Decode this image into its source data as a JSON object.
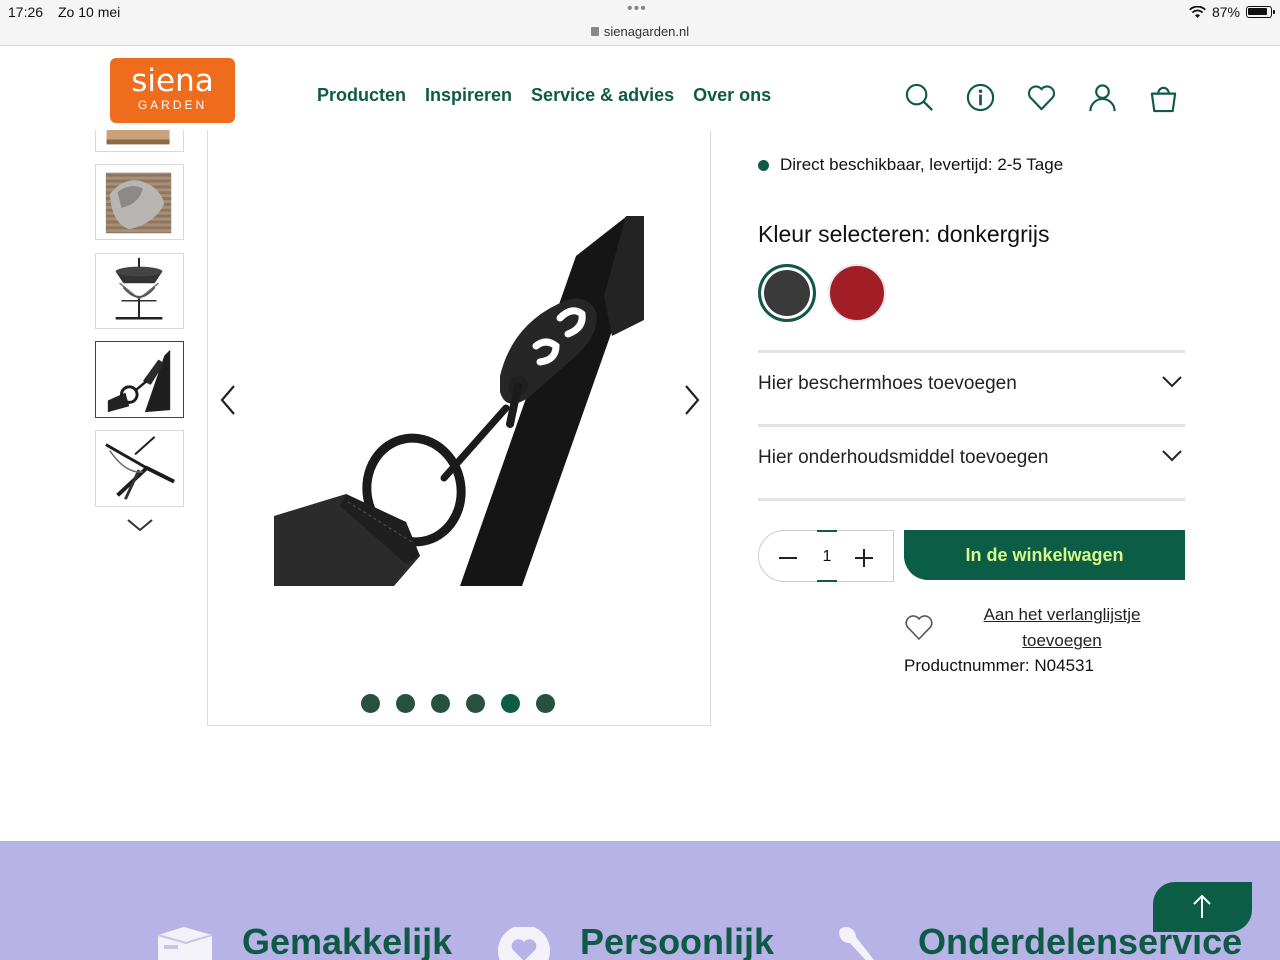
{
  "status_bar": {
    "time": "17:26",
    "date": "Zo 10 mei",
    "url": "sienagarden.nl",
    "battery": "87%"
  },
  "header": {
    "logo_line1": "siena",
    "logo_line2": "GARDEN",
    "nav": [
      "Producten",
      "Inspireren",
      "Service & advies",
      "Over ons"
    ],
    "icons": [
      "search-icon",
      "info-icon",
      "heart-icon",
      "user-icon",
      "bag-icon"
    ]
  },
  "gallery": {
    "thumbnails": [
      "thumb-partial",
      "thumb-cushion",
      "thumb-stand",
      "thumb-hook",
      "thumb-frame"
    ],
    "selected_thumbnail": 3,
    "slide_count": 6,
    "active_slide": 4
  },
  "product": {
    "availability": "Direct beschikbaar, levertijd: 2-5 Tage",
    "color_label": "Kleur selecteren: donkergrijs",
    "colors": [
      {
        "name": "donkergrijs",
        "hex": "#3a3a3a",
        "selected": true
      },
      {
        "name": "rood",
        "hex": "#a21e26",
        "selected": false
      }
    ],
    "accordions": [
      "Hier beschermhoes toevoegen",
      "Hier onderhoudsmiddel toevoegen"
    ],
    "quantity": "1",
    "add_to_cart": "In de winkelwagen",
    "wishlist_line1": "Aan het verlanglijstje",
    "wishlist_line2": "toevoegen",
    "product_number": "Productnummer: N04531"
  },
  "footer": {
    "items": [
      "Gemakkelijk",
      "Persoonlijk",
      "Onderdelenservice"
    ]
  },
  "colors": {
    "brand_green": "#0f5a46",
    "brand_orange": "#ef6c1c",
    "cta_text": "#d8f78b",
    "footer_bg": "#b7b3e6"
  }
}
